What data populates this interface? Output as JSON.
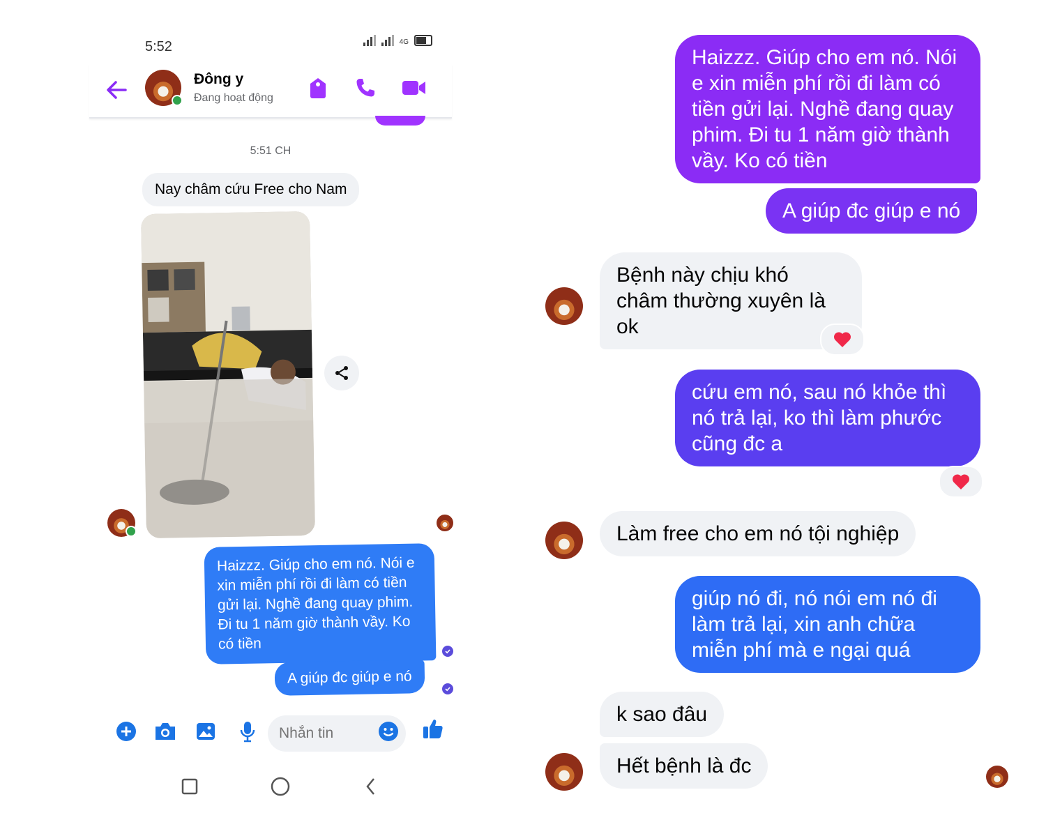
{
  "status_bar": {
    "time": "5:52",
    "network": "4G"
  },
  "header": {
    "contact_name": "Đông y",
    "contact_status": "Đang hoạt động"
  },
  "conversation_left": {
    "timestamp": "5:51 CH",
    "incoming_text": "Nay châm cứu Free cho Nam",
    "outgoing": [
      "Haizzz. Giúp cho em nó. Nói e xin miễn phí rồi đi làm có tiền gửi lại. Nghề đang quay phim. Đi tu 1 năm giờ thành vầy. Ko có tiền",
      "A giúp đc giúp e nó"
    ]
  },
  "composer": {
    "placeholder": "Nhắn tin"
  },
  "conversation_right": {
    "messages": [
      {
        "dir": "out",
        "text": "Haizzz. Giúp cho em nó. Nói e xin miễn phí rồi đi làm có tiền gửi lại. Nghề đang quay phim. Đi tu 1 năm giờ thành vầy. Ko có tiền"
      },
      {
        "dir": "out",
        "text": "A giúp đc giúp e nó"
      },
      {
        "dir": "in",
        "text": "Bệnh này chịu khó châm thường xuyên là ok",
        "reaction": "heart"
      },
      {
        "dir": "out",
        "text": "cứu em nó, sau nó khỏe thì nó trả lại, ko thì làm phước cũng đc a",
        "reaction": "heart"
      },
      {
        "dir": "in",
        "text": "Làm free cho em nó tội nghiệp"
      },
      {
        "dir": "out",
        "text": "giúp nó đi, nó nói em nó đi làm trả lại, xin anh chữa miễn phí mà e ngại quá"
      },
      {
        "dir": "in",
        "text": "k sao đâu"
      },
      {
        "dir": "in",
        "text": "Hết bệnh là đc"
      }
    ]
  },
  "colors": {
    "accent": "#a033ff",
    "messenger_blue": "#2f7cf6",
    "heart": "#f02849",
    "online": "#31a24c"
  }
}
